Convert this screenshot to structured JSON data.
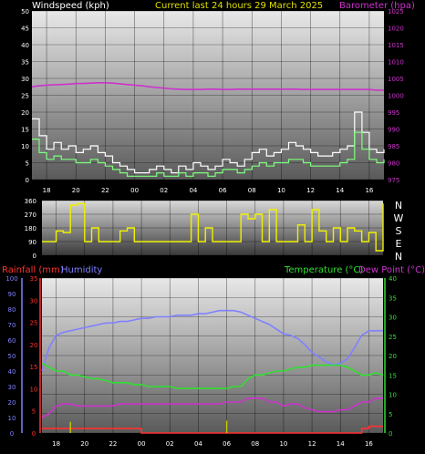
{
  "header": {
    "windspeed_label": "Windspeed (kph)",
    "title": "Current last 24 hours 29 March 2025",
    "barometer_label": "Barometer (hpa)"
  },
  "colors": {
    "background": "#000000",
    "panel_top": "#e8e8e8",
    "panel_bottom": "#606060",
    "wind_color": "#ffffff",
    "gust_color": "#7cff7c",
    "barometer_color": "#cc33cc",
    "direction_color": "#f0f000",
    "rain_color": "#ff3030",
    "humidity_color": "#8080ff",
    "temperature_color": "#30e030",
    "dewpoint_color": "#cc33cc",
    "rain_rate_color": "#c8c800",
    "left_axis_color": "#ffffff",
    "right_axis_color": "#cc33cc"
  },
  "time_ticks": [
    "18",
    "20",
    "22",
    "00",
    "02",
    "04",
    "06",
    "08",
    "10",
    "12",
    "14",
    "16"
  ],
  "direction_labels": [
    "N",
    "W",
    "S",
    "E",
    "N"
  ],
  "bottom_legend": {
    "rainfall": "Rainfall (mm)",
    "humidity": "Humidity",
    "temperature": "Temperature (°C)",
    "dewpoint": "Dew Point (°C)"
  },
  "chart_data": [
    {
      "type": "line",
      "title": "Current last 24 hours 29 March 2025",
      "x": [
        17.0,
        17.5,
        18.0,
        18.5,
        19.0,
        19.5,
        20.0,
        20.5,
        21.0,
        21.5,
        22.0,
        22.5,
        23.0,
        23.5,
        24.0,
        24.5,
        25.0,
        25.5,
        26.0,
        26.5,
        27.0,
        27.5,
        28.0,
        28.5,
        29.0,
        29.5,
        30.0,
        30.5,
        31.0,
        31.5,
        32.0,
        32.5,
        33.0,
        33.5,
        34.0,
        34.5,
        35.0,
        35.5,
        36.0,
        36.5,
        37.0,
        37.5,
        38.0,
        38.5,
        39.0,
        39.5,
        40.0,
        40.5,
        41.0
      ],
      "x_tick_labels": [
        "18",
        "20",
        "22",
        "00",
        "02",
        "04",
        "06",
        "08",
        "10",
        "12",
        "14",
        "16"
      ],
      "series": [
        {
          "name": "Windspeed (kph)",
          "axis": "left",
          "values": [
            18,
            13,
            9,
            11,
            9,
            10,
            8,
            9,
            10,
            8,
            7,
            5,
            4,
            3,
            2,
            2,
            3,
            4,
            3,
            2,
            4,
            3,
            5,
            4,
            3,
            4,
            6,
            5,
            4,
            6,
            8,
            9,
            7,
            8,
            9,
            11,
            10,
            9,
            8,
            7,
            7,
            8,
            9,
            10,
            20,
            14,
            9,
            8,
            9
          ]
        },
        {
          "name": "Gust",
          "axis": "left",
          "values": [
            12,
            8,
            6,
            7,
            6,
            6,
            5,
            5,
            6,
            5,
            4,
            3,
            2,
            1,
            1,
            1,
            1,
            2,
            1,
            1,
            2,
            1,
            2,
            2,
            1,
            2,
            3,
            3,
            2,
            3,
            4,
            5,
            4,
            5,
            5,
            6,
            6,
            5,
            4,
            4,
            4,
            4,
            5,
            6,
            14,
            9,
            6,
            5,
            6
          ]
        },
        {
          "name": "Barometer (hpa)",
          "axis": "right",
          "values": [
            1002.5,
            1002.8,
            1003.0,
            1003.1,
            1003.2,
            1003.3,
            1003.5,
            1003.5,
            1003.6,
            1003.7,
            1003.7,
            1003.6,
            1003.4,
            1003.2,
            1003.0,
            1002.8,
            1002.5,
            1002.3,
            1002.1,
            1001.9,
            1001.8,
            1001.7,
            1001.7,
            1001.7,
            1001.8,
            1001.8,
            1001.7,
            1001.7,
            1001.8,
            1001.8,
            1001.8,
            1001.8,
            1001.8,
            1001.8,
            1001.8,
            1001.8,
            1001.8,
            1001.7,
            1001.7,
            1001.7,
            1001.7,
            1001.7,
            1001.7,
            1001.7,
            1001.7,
            1001.7,
            1001.7,
            1001.5,
            1001.5
          ]
        }
      ],
      "xlabel": "",
      "ylabel": "Windspeed (kph)",
      "ylim": [
        0,
        50
      ],
      "y_ticks": [
        0,
        5,
        10,
        15,
        20,
        25,
        30,
        35,
        40,
        45,
        50
      ],
      "ylabel_right": "Barometer (hpa)",
      "ylim_right": [
        975,
        1025
      ],
      "y_ticks_right": [
        975,
        980,
        985,
        990,
        995,
        1000,
        1005,
        1010,
        1015,
        1020,
        1025
      ],
      "grid": true
    },
    {
      "type": "line",
      "title": "",
      "x": [
        17.0,
        17.5,
        18.0,
        18.5,
        19.0,
        19.5,
        20.0,
        20.5,
        21.0,
        21.5,
        22.0,
        22.5,
        23.0,
        23.5,
        24.0,
        24.5,
        25.0,
        25.5,
        26.0,
        26.5,
        27.0,
        27.5,
        28.0,
        28.5,
        29.0,
        29.5,
        30.0,
        30.5,
        31.0,
        31.5,
        32.0,
        32.5,
        33.0,
        33.5,
        34.0,
        34.5,
        35.0,
        35.5,
        36.0,
        36.5,
        37.0,
        37.5,
        38.0,
        38.5,
        39.0,
        39.5,
        40.0,
        40.5,
        41.0
      ],
      "series": [
        {
          "name": "Wind direction",
          "values": [
            90,
            90,
            160,
            150,
            330,
            340,
            90,
            180,
            90,
            90,
            90,
            160,
            180,
            90,
            90,
            90,
            90,
            90,
            90,
            90,
            90,
            270,
            90,
            180,
            90,
            90,
            90,
            90,
            270,
            240,
            270,
            90,
            300,
            90,
            90,
            90,
            200,
            90,
            300,
            160,
            90,
            180,
            90,
            180,
            160,
            90,
            150,
            30,
            340
          ]
        }
      ],
      "ylim": [
        0,
        360
      ],
      "y_ticks": [
        0,
        90,
        180,
        270,
        360
      ],
      "grid": true
    },
    {
      "type": "line",
      "title": "",
      "x": [
        17.0,
        17.5,
        18.0,
        18.5,
        19.0,
        19.5,
        20.0,
        20.5,
        21.0,
        21.5,
        22.0,
        22.5,
        23.0,
        23.5,
        24.0,
        24.5,
        25.0,
        25.5,
        26.0,
        26.5,
        27.0,
        27.5,
        28.0,
        28.5,
        29.0,
        29.5,
        30.0,
        30.5,
        31.0,
        31.5,
        32.0,
        32.5,
        33.0,
        33.5,
        34.0,
        34.5,
        35.0,
        35.5,
        36.0,
        36.5,
        37.0,
        37.5,
        38.0,
        38.5,
        39.0,
        39.5,
        40.0,
        40.5,
        41.0
      ],
      "series": [
        {
          "name": "Humidity",
          "axis": "left-outer",
          "values": [
            40,
            55,
            63,
            65,
            66,
            67,
            68,
            69,
            70,
            71,
            71,
            72,
            72,
            73,
            74,
            74,
            75,
            75,
            75,
            76,
            76,
            76,
            77,
            77,
            78,
            79,
            79,
            79,
            78,
            76,
            74,
            72,
            70,
            67,
            64,
            63,
            61,
            57,
            52,
            49,
            46,
            44,
            45,
            48,
            55,
            63,
            66,
            66,
            66
          ]
        },
        {
          "name": "Temperature (°C)",
          "axis": "right",
          "values": [
            18,
            17,
            16,
            16,
            15,
            15,
            14.5,
            14,
            14,
            13.5,
            13,
            13,
            13,
            12.5,
            12.5,
            12,
            12,
            12,
            12,
            11.5,
            11.5,
            11.5,
            11.5,
            11.5,
            11.5,
            11.5,
            11.5,
            12,
            12,
            14,
            15,
            15,
            15.5,
            16,
            16,
            16.5,
            17,
            17,
            17.5,
            17.5,
            17.5,
            17.5,
            17.5,
            17,
            16,
            15,
            15,
            15.5,
            15
          ]
        },
        {
          "name": "Dew Point (°C)",
          "axis": "right",
          "values": [
            4,
            5,
            7,
            7.5,
            7.5,
            7,
            7,
            7,
            7,
            7,
            7,
            7.5,
            7.5,
            7.5,
            7.5,
            7.5,
            7.5,
            7.5,
            7.5,
            7.5,
            7.5,
            7.5,
            7.5,
            7.5,
            7.5,
            7.5,
            8,
            8,
            8,
            9,
            9,
            9,
            8,
            8,
            7,
            7.5,
            7.5,
            6.5,
            6,
            5.5,
            5.5,
            5.5,
            6,
            6,
            7,
            8,
            8,
            9,
            9
          ]
        },
        {
          "name": "Rainfall (mm)",
          "axis": "left-inner",
          "values": [
            1,
            1,
            1,
            1,
            1,
            1,
            1,
            1,
            1,
            1,
            1,
            1,
            1,
            1,
            0,
            0,
            0,
            0,
            0,
            0,
            0,
            0,
            0,
            0,
            0,
            0,
            0,
            0,
            0,
            0,
            0,
            0,
            0,
            0,
            0,
            0,
            0,
            0,
            0,
            0,
            0,
            0,
            0,
            0,
            0,
            1,
            1.5,
            1.5,
            1.5
          ]
        },
        {
          "name": "Rain rate",
          "values": [
            0,
            0,
            0,
            0,
            2.5,
            0,
            0,
            0,
            0,
            0,
            0,
            0,
            0,
            0,
            0,
            0,
            0,
            0,
            0,
            0,
            0,
            0,
            0,
            0,
            0,
            0,
            2.8,
            0,
            0,
            0,
            0,
            0,
            0,
            0,
            0,
            0,
            0,
            0,
            0,
            0,
            0,
            0,
            0,
            0,
            0,
            0,
            0,
            0,
            0
          ]
        }
      ],
      "ylabel_left_outer": "Humidity",
      "ylim_left_outer": [
        0,
        100
      ],
      "y_ticks_left_outer": [
        0,
        10,
        20,
        30,
        40,
        50,
        60,
        70,
        80,
        90,
        100
      ],
      "ylabel_left_inner": "Rainfall (mm)",
      "ylim_left_inner": [
        0,
        35
      ],
      "y_ticks_left_inner": [
        0,
        5,
        10,
        15,
        20,
        25,
        30,
        35
      ],
      "ylabel_right": "Temperature (°C)",
      "ylim_right": [
        -5,
        40
      ],
      "y_ticks_right": [
        0,
        5,
        10,
        15,
        20,
        25,
        30,
        35,
        40
      ],
      "grid": true
    }
  ]
}
